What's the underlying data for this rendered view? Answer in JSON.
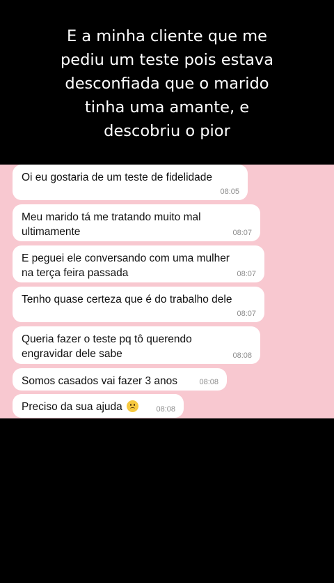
{
  "caption": {
    "lines": [
      "E a minha cliente que me",
      "pediu um teste pois estava",
      "desconfiada que o marido",
      "tinha uma amante, e",
      "descobriu o pior"
    ]
  },
  "messages": [
    {
      "lines": [
        "Oi eu gostaria de um teste de fidelidade"
      ],
      "time": "08:05"
    },
    {
      "lines": [
        "Meu marido tá me tratando muito mal",
        "ultimamente"
      ],
      "time": "08:07"
    },
    {
      "lines": [
        "E peguei ele conversando com uma mulher",
        "na terça feira passada"
      ],
      "time": "08:07"
    },
    {
      "lines": [
        "Tenho quase certeza que é do trabalho dele"
      ],
      "time": "08:07"
    },
    {
      "lines": [
        "Queria fazer o teste pq tô querendo",
        "engravidar dele sabe"
      ],
      "time": "08:08"
    },
    {
      "lines": [
        "Somos casados vai fazer 3 anos"
      ],
      "time": "08:08"
    },
    {
      "lines": [
        "Preciso da sua ajuda"
      ],
      "emoji": "worried-face-emoji",
      "time": "08:08"
    }
  ]
}
